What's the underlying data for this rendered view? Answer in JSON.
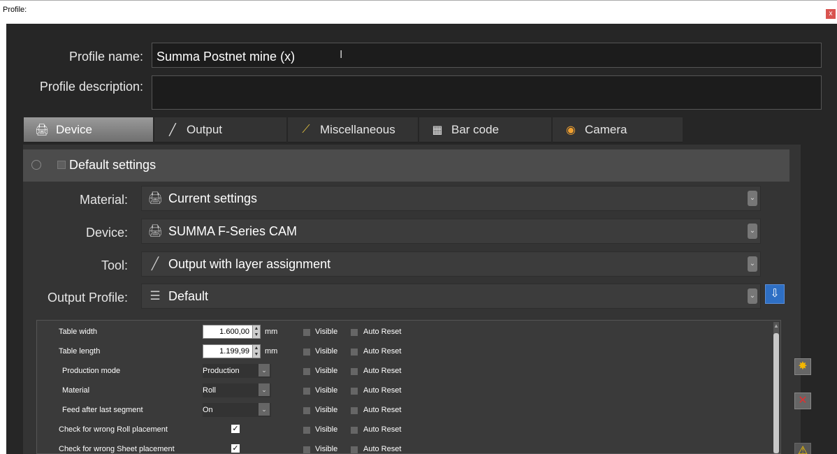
{
  "window": {
    "title": "Profile:",
    "close_label": "x"
  },
  "profile": {
    "name_label": "Profile name:",
    "name_value": "Summa Postnet mine (x)",
    "description_label": "Profile description:",
    "description_value": ""
  },
  "tabs": [
    {
      "label": "Device",
      "icon": "device-icon",
      "active": true
    },
    {
      "label": "Output",
      "icon": "pen-icon"
    },
    {
      "label": "Miscellaneous",
      "icon": "wand-icon"
    },
    {
      "label": "Bar code",
      "icon": "barcode-icon"
    },
    {
      "label": "Camera",
      "icon": "eye-icon"
    }
  ],
  "default_settings": {
    "label": "Default settings"
  },
  "fields": {
    "material": {
      "label": "Material:",
      "value": "Current settings",
      "icon": "printer-icon"
    },
    "device": {
      "label": "Device:",
      "value": "SUMMA F-Series CAM",
      "icon": "printer-check-icon"
    },
    "tool": {
      "label": "Tool:",
      "value": "Output with layer assignment",
      "icon": "pen-icon"
    },
    "output_profile": {
      "label": "Output Profile:",
      "value": "Default",
      "icon": "database-icon"
    }
  },
  "grid": {
    "visible_label": "Visible",
    "autoreset_label": "Auto Reset",
    "rows": [
      {
        "name": "Table width",
        "value": "1.600,00",
        "unit": "mm"
      },
      {
        "name": "Table length",
        "value": "1.199,99",
        "unit": "mm"
      },
      {
        "name": "Production mode",
        "value": "Production"
      },
      {
        "name": "Material",
        "value": "Roll"
      },
      {
        "name": "Feed after last segment",
        "value": "On"
      },
      {
        "name": "Check for wrong Roll placement",
        "checked": true
      },
      {
        "name": "Check for wrong Sheet placement",
        "checked": true
      }
    ]
  }
}
